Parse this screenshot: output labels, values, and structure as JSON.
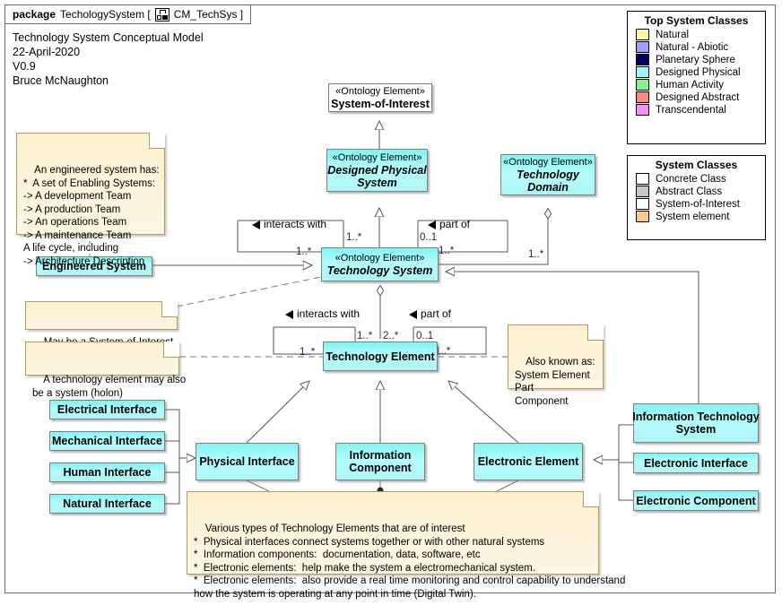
{
  "package": {
    "keyword": "package",
    "name": "TechologySystem [",
    "icon": "package-diagram-icon",
    "diagram_id": "CM_TechSys ]"
  },
  "header_block": "Technology System Conceptual Model\n22-April-2020\nV0.9\nBruce McNaughton",
  "title": "Technology System\nConceptual Model",
  "legends": [
    {
      "id": "top-system-classes",
      "title": "Top System Classes",
      "rows": [
        {
          "label": "Natural",
          "color": "#fbf8a0"
        },
        {
          "label": "Natural - Abiotic",
          "color": "#a0a0fb"
        },
        {
          "label": "Planetary Sphere",
          "color": "#000060"
        },
        {
          "label": "Designed Physical",
          "color": "#9ef6f6"
        },
        {
          "label": "Human Activity",
          "color": "#88f08c"
        },
        {
          "label": "Designed Abstract",
          "color": "#f88a80"
        },
        {
          "label": "Transcendental",
          "color": "#fa8cfa"
        }
      ]
    },
    {
      "id": "system-classes",
      "title": "System Classes",
      "rows": [
        {
          "label": "Concrete Class",
          "color": "#ffffff"
        },
        {
          "label": "Abstract Class",
          "color": "#c8c8c8"
        },
        {
          "label": "System-of-Interest",
          "color": "#ffffff"
        },
        {
          "label": "System element",
          "color": "#fbc78a"
        }
      ]
    }
  ],
  "classes": {
    "system_of_interest": {
      "stereotype": "«Ontology Element»",
      "name": "System-of-Interest"
    },
    "designed_physical": {
      "stereotype": "«Ontology Element»",
      "name": "Designed Physical\nSystem"
    },
    "technology_domain": {
      "stereotype": "«Ontology Element»",
      "name": "Technology\nDomain"
    },
    "technology_system": {
      "stereotype": "«Ontology Element»",
      "name": "Technology System"
    },
    "engineered_system": {
      "stereotype": "",
      "name": "Engineered System"
    },
    "technology_element": {
      "stereotype": "",
      "name": "Technology Element"
    },
    "electrical_interface": {
      "stereotype": "",
      "name": "Electrical Interface"
    },
    "mechanical_interface": {
      "stereotype": "",
      "name": "Mechanical Interface"
    },
    "human_interface": {
      "stereotype": "",
      "name": "Human Interface"
    },
    "natural_interface": {
      "stereotype": "",
      "name": "Natural Interface"
    },
    "physical_interface": {
      "stereotype": "",
      "name": "Physical Interface"
    },
    "information_component": {
      "stereotype": "",
      "name": "Information\nComponent"
    },
    "electronic_element": {
      "stereotype": "",
      "name": "Electronic Element"
    },
    "information_technology_system": {
      "stereotype": "",
      "name": "Information Technology\nSystem"
    },
    "electronic_interface": {
      "stereotype": "",
      "name": "Electronic Interface"
    },
    "electronic_component": {
      "stereotype": "",
      "name": "Electronic Component"
    }
  },
  "notes": {
    "engineered_system_note": "An engineered system has:\n*  A set of Enabling Systems:\n-> A development Team\n-> A production Team\n-> An operations Team\n-> A maintenance Team\nA life cycle, including\n-> Architecture Description",
    "soi_note": "May be a System-of-Interest",
    "holon_note": "A technology element may also\nbe a system (holon)",
    "aka_note": "Also known as:\nSystem Element\nPart\nComponent",
    "types_note": "Various types of Technology Elements that are of interest\n*  Physical interfaces connect systems together or with other natural systems\n*  Information components:  documentation, data, software, etc\n*  Electronic elements:  help make the system a electromechanical system.\n*  Electronic elements:  also provide a real time monitoring and control capability to understand\nhow the system is operating at any point in time (Digital Twin)."
  },
  "relationships": {
    "ts_interacts_with": {
      "label": "interacts with",
      "source_mult": "1..*",
      "target_mult": "1..*"
    },
    "ts_part_of": {
      "label": "part of",
      "source_mult": "0..1",
      "target_mult": "1..*"
    },
    "ts_domain_mult": "1..*",
    "te_interacts_with": {
      "label": "interacts with",
      "source_mult": "1..*",
      "target_mult": "1..*"
    },
    "te_part_of": {
      "label": "part of",
      "source_mult": "0..1",
      "target_mult": "1..*"
    },
    "te_composition_mult": "2..*"
  },
  "colors": {
    "class_fill": "#aef6f6",
    "note_fill": "#fdf3d8",
    "line": "#56565a",
    "multiplicity_text": "#2a1a44"
  }
}
